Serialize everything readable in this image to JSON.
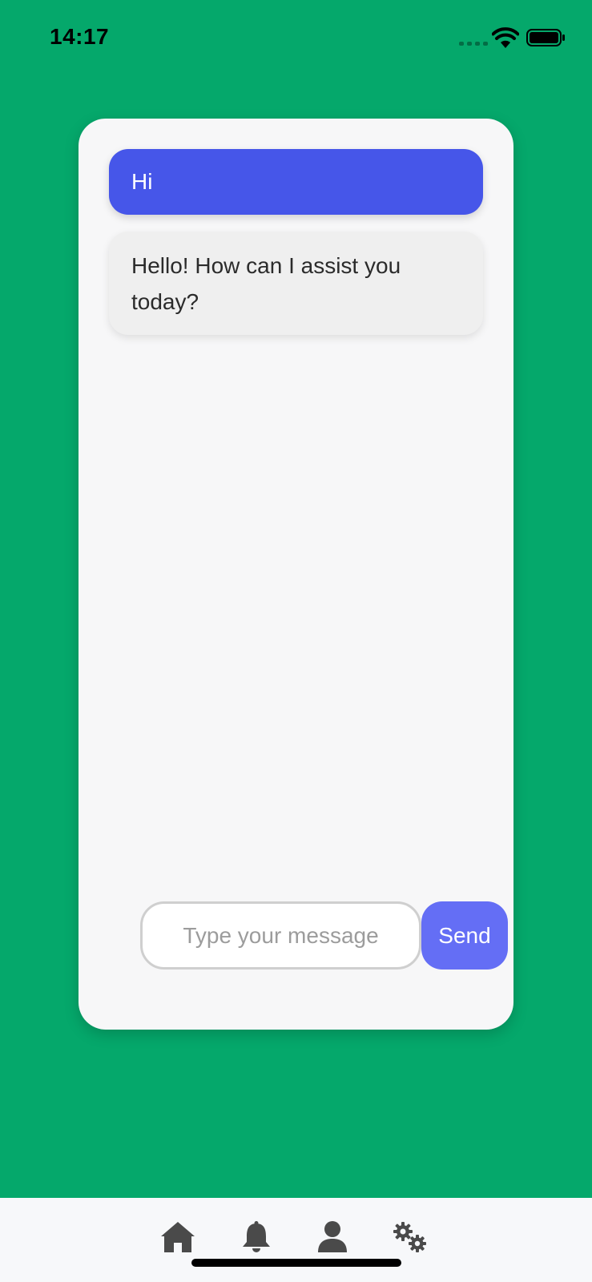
{
  "status_bar": {
    "time": "14:17"
  },
  "chat": {
    "messages": [
      {
        "role": "user",
        "text": "Hi"
      },
      {
        "role": "assistant",
        "text": "Hello! How can I assist you today?"
      }
    ],
    "input_placeholder": "Type your message",
    "input_value": "",
    "send_label": "Send"
  },
  "bottom_nav": {
    "items": [
      {
        "icon": "home-icon"
      },
      {
        "icon": "bell-icon"
      },
      {
        "icon": "user-icon"
      },
      {
        "icon": "gears-icon"
      }
    ]
  },
  "colors": {
    "background": "#05a86b",
    "user_bubble": "#4656e9",
    "send_button": "#646ef5",
    "assistant_bubble": "#efefef",
    "icon": "#4a4a4a"
  }
}
